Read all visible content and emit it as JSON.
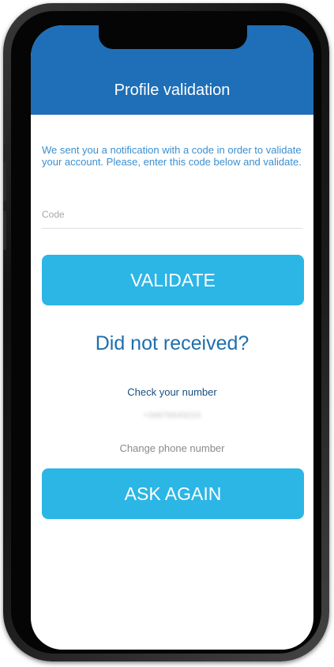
{
  "header": {
    "title": "Profile validation"
  },
  "main": {
    "intro_text": "We sent you a notification with a code in order to validate your account. Please, enter this code below and validate.",
    "code_placeholder": "Code",
    "validate_label": "VALIDATE",
    "not_received_text": "Did not received?",
    "check_number_label": "Check your number",
    "phone_number": "+34676543210",
    "change_phone_label": "Change phone number",
    "ask_again_label": "ASK AGAIN"
  },
  "colors": {
    "header_blue": "#1e6fb8",
    "button_cyan": "#2bb6e6",
    "accent_text": "#1d6fae"
  }
}
